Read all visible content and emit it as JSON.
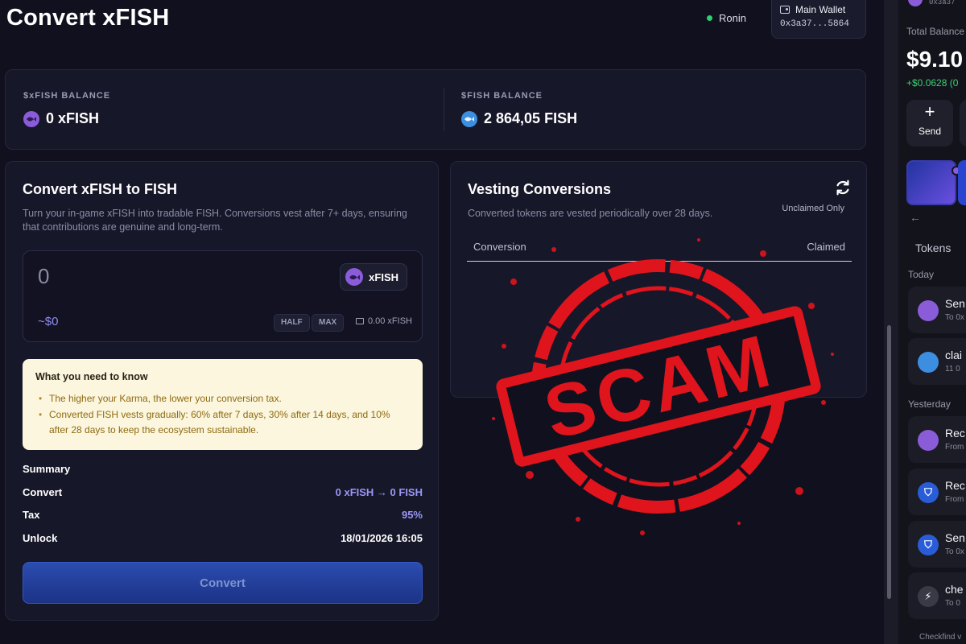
{
  "header": {
    "title": "Convert xFISH",
    "network": "Ronin",
    "wallet_label": "Main Wallet",
    "wallet_address": "0x3a37...5864"
  },
  "balances": {
    "xfish_label": "$xFISH BALANCE",
    "xfish_value": "0 xFISH",
    "fish_label": "$FISH BALANCE",
    "fish_value": "2 864,05 FISH"
  },
  "convert": {
    "title": "Convert xFISH to FISH",
    "description": "Turn your in-game xFISH into tradable FISH. Conversions vest after 7+ days, ensuring that contributions are genuine and long-term.",
    "amount": "0",
    "token": "xFISH",
    "usd_value": "~$0",
    "half_label": "HALF",
    "max_label": "MAX",
    "available": "0.00 xFISH",
    "info_title": "What you need to know",
    "info_items": [
      "The higher your Karma, the lower your conversion tax.",
      "Converted FISH vests gradually: 60% after 7 days, 30% after 14 days, and 10% after 28 days to keep the ecosystem sustainable."
    ],
    "summary_label": "Summary",
    "convert_label": "Convert",
    "convert_value": "0 xFISH → 0 FISH",
    "tax_label": "Tax",
    "tax_value": "95%",
    "unlock_label": "Unlock",
    "unlock_value": "18/01/2026 16:05",
    "button_label": "Convert"
  },
  "vesting": {
    "title": "Vesting Conversions",
    "description": "Converted tokens are vested periodically over 28 days.",
    "filter_label": "Unclaimed Only",
    "col_conversion": "Conversion",
    "col_claimed": "Claimed"
  },
  "stamp": {
    "text": "SCAM",
    "color": "#e0141c"
  },
  "sidebar": {
    "address": "0x3a37",
    "total_balance_label": "Total Balance",
    "total_balance": "$9.10",
    "delta": "+$0.0628 (0",
    "action_label": "Send",
    "tokens_tab": "Tokens",
    "today_label": "Today",
    "yesterday_label": "Yesterday",
    "items": [
      {
        "title": "Sen",
        "sub": "To 0x",
        "icon": "fish-icon",
        "color": "#8a5cd8"
      },
      {
        "title": "clai",
        "sub": "11 0",
        "icon": "fish-icon",
        "color": "#3c8fe0"
      },
      {
        "title": "Rec",
        "sub": "From",
        "icon": "fish-icon",
        "color": "#8a5cd8"
      },
      {
        "title": "Rec",
        "sub": "From",
        "icon": "ronin-icon",
        "color": "#2a5cd8"
      },
      {
        "title": "Sen",
        "sub": "To 0x",
        "icon": "ronin-icon",
        "color": "#2a5cd8"
      },
      {
        "title": "che",
        "sub": "To 0",
        "icon": "bolt-icon",
        "color": "#3a3a46"
      }
    ],
    "footer": "Checkfind v"
  }
}
